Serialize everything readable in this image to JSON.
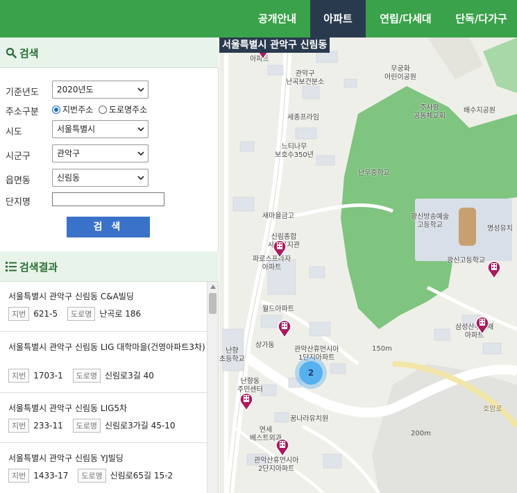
{
  "nav": {
    "tabs": [
      {
        "label": "공개안내"
      },
      {
        "label": "아파트"
      },
      {
        "label": "연립/다세대"
      },
      {
        "label": "단독/다가구"
      }
    ],
    "active_index": 1
  },
  "search": {
    "title": "검색",
    "year_label": "기준년도",
    "year_value": "2020년도",
    "addr_type_label": "주소구분",
    "addr_opt1": "지번주소",
    "addr_opt2": "도로명주소",
    "sido_label": "시도",
    "sido_value": "서울특별시",
    "sigungu_label": "시군구",
    "sigungu_value": "관악구",
    "emd_label": "읍면동",
    "emd_value": "신림동",
    "complex_label": "단지명",
    "complex_value": "",
    "button_label": "검 색"
  },
  "results": {
    "title": "검색결과",
    "jibun_badge": "지번",
    "road_badge": "도로명",
    "items": [
      {
        "name": "서울특별시 관악구 신림동 C&A빌딩",
        "jibun": "621-5",
        "road": "난곡로 186"
      },
      {
        "name": "서울특별시 관악구 신림동 LIG 대학마을(건영아파트3차)",
        "jibun": "1703-1",
        "road": "신림로3길 40"
      },
      {
        "name": "서울특별시 관악구 신림동 LIG5차",
        "jibun": "233-11",
        "road": "신림로3가길 45-10"
      },
      {
        "name": "서울특별시 관악구 신림동 YJ빌딩",
        "jibun": "1433-17",
        "road": "신림로65길 15-2"
      }
    ]
  },
  "map": {
    "region_title": "서울특별시 관악구 신림동",
    "cluster_count": "2",
    "scale_150": "150m",
    "scale_200": "200m",
    "labels": {
      "apt_top": "아파트",
      "health": "관악구\n난곡보건분소",
      "mugunghwa": "무궁화\n어린이공원",
      "sejong": "세종프라임",
      "susang": "주사랑\n공동체교회",
      "baesu": "배수지공원",
      "neutinamu": "느티나무\n보호수350년",
      "nanwoo": "난우중학교",
      "saemaeul": "새마을금고",
      "gwangsin_art": "광신방송예술\n고등학교",
      "myungsung": "명성유치",
      "sillim_complex": "신림종합\n사회복지관",
      "forest": "파로스프라자\n아파트",
      "gwangsin_high": "광신고등학교",
      "world": "월드아파트",
      "sanga": "상가동",
      "gwanak_apt1": "관악산휴먼시아\n1단지아파트",
      "samsung": "삼성산주공채\n아파트",
      "nanhyang_school": "난향\n초등학교",
      "nanhyang_center": "난향동\n주민센터",
      "kkum": "꿈나라유치원",
      "yonse": "연세\n베스트외과",
      "gwanak_apt2": "관악산휴먼시아\n2단지아파트",
      "homangro": "호암로"
    }
  },
  "colors": {
    "nav_green": "#3aa24a",
    "nav_active": "#2a3a4e",
    "section_head": "#e8f4ea",
    "button_blue": "#3a72c9",
    "marker_magenta": "#b0185e",
    "park_green": "#7fc47f"
  }
}
